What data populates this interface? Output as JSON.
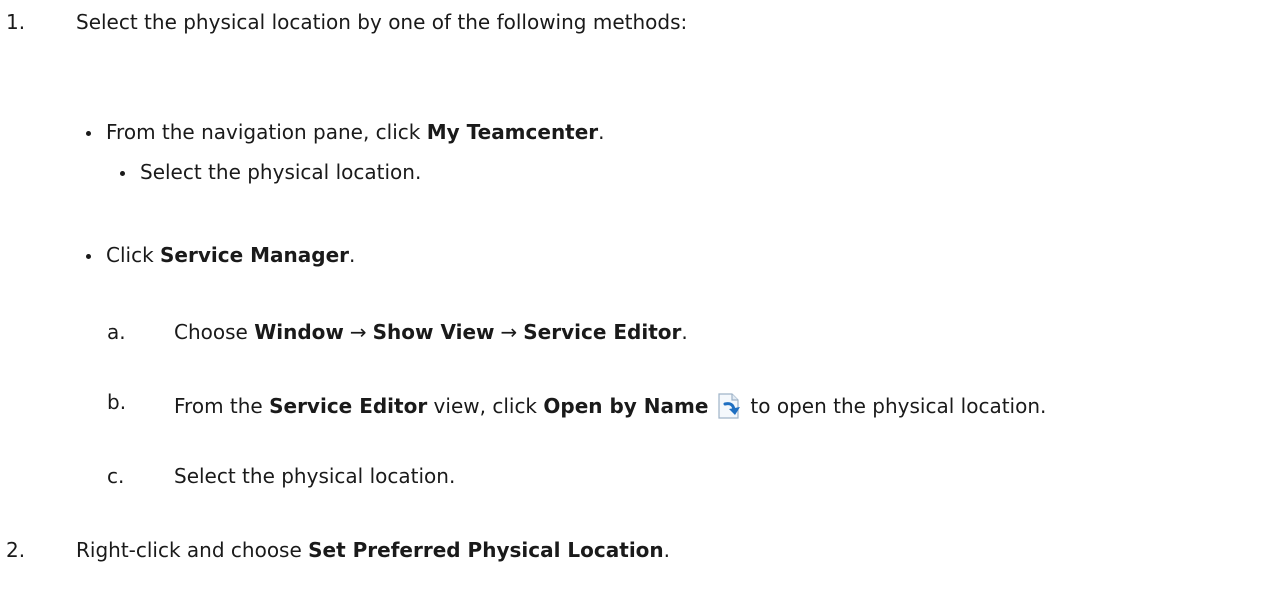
{
  "steps": [
    {
      "marker": "1.",
      "text": "Select the physical location by one of the following methods:"
    },
    {
      "bullet_1": {
        "pre": "From the navigation pane, click ",
        "bold": "My Teamcenter",
        "post": "."
      },
      "sub_bullet_1": {
        "text": "Select the physical location."
      },
      "bullet_2": {
        "pre": "Click ",
        "bold": "Service Manager",
        "post": "."
      },
      "sub_a": {
        "marker": "a.",
        "pre": "Choose ",
        "b1": "Window",
        "arrow1": "→",
        "b2": "Show View",
        "arrow2": "→",
        "b3": "Service Editor",
        "post": "."
      },
      "sub_b": {
        "marker": "b.",
        "pre": "From the ",
        "b1": "Service Editor",
        "mid": " view, click ",
        "b2": "Open by Name",
        "icon": "open-by-name-icon",
        "post": "to open the physical location."
      },
      "sub_c": {
        "marker": "c.",
        "text": "Select the physical location."
      }
    },
    {
      "marker": "2.",
      "pre": "Right-click and choose ",
      "bold": "Set Preferred Physical Location",
      "post": "."
    }
  ]
}
